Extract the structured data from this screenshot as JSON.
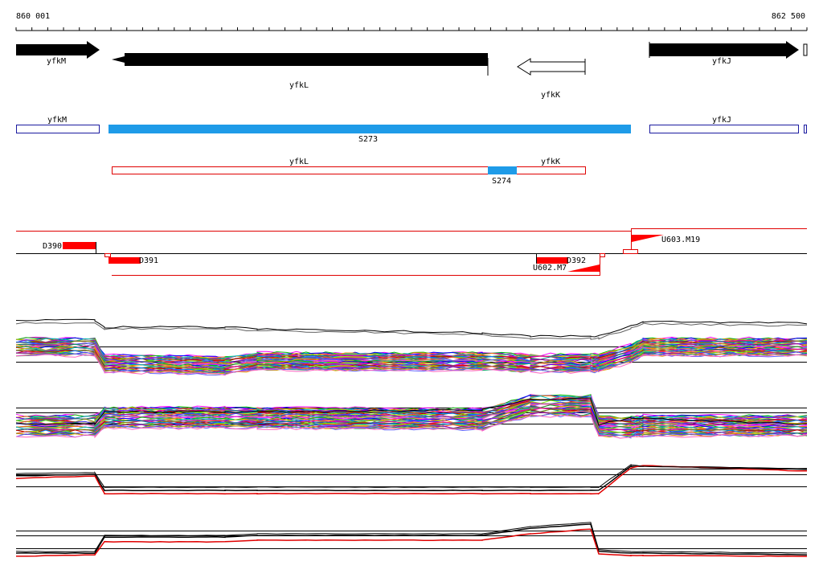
{
  "ruler": {
    "start": "860 001",
    "end": "862 500"
  },
  "genes": [
    {
      "name": "yfkM",
      "strand": "+",
      "start": 860001,
      "end": 860264,
      "style": "filled"
    },
    {
      "name": "yfkL",
      "strand": "-",
      "start": 860300,
      "end": 861500,
      "style": "filled"
    },
    {
      "name": "yfkK",
      "strand": "-",
      "start": 861590,
      "end": 861809,
      "style": "hollow"
    },
    {
      "name": "yfkJ",
      "strand": "+",
      "start": 861999,
      "end": 862484,
      "style": "filled"
    },
    {
      "name": "",
      "strand": "+",
      "start": 862485,
      "end": 862500,
      "style": "hollow"
    }
  ],
  "annotation_row1": [
    {
      "label": "yfkM",
      "start": 860001,
      "end": 860264,
      "color": "#1a1aa0"
    },
    {
      "label": "S273",
      "start": 860289,
      "end": 861939,
      "color": "#1e9be8",
      "filled": true
    },
    {
      "label": "yfkJ",
      "start": 861999,
      "end": 862484,
      "color": "#1a1aa0"
    },
    {
      "label": "",
      "start": 862490,
      "end": 862500,
      "color": "#1a1aa0"
    }
  ],
  "annotation_row2": [
    {
      "label": "yfkL",
      "start": 860300,
      "end": 861500,
      "color": "#e00000"
    },
    {
      "label": "S274",
      "start": 861500,
      "end": 861590,
      "color": "#1e9be8",
      "filled": true
    },
    {
      "label": "yfkK",
      "start": 861590,
      "end": 861809,
      "color": "#e00000"
    }
  ],
  "features": [
    {
      "label": "D390",
      "type": "block",
      "start": 860150,
      "end": 860250
    },
    {
      "label": "D391",
      "type": "block",
      "start": 860289,
      "end": 860390
    },
    {
      "label": "D392",
      "type": "block",
      "start": 861500,
      "end": 861590
    },
    {
      "label": "U602.M7",
      "type": "flag-up"
    },
    {
      "label": "U603.M19",
      "type": "flag-down"
    }
  ],
  "colors": {
    "gene_fill": "#000000",
    "annotation_blue": "#1e9be8",
    "outline_blue": "#1a1aa0",
    "outline_red": "#e00000",
    "feature_red": "#ff0000"
  }
}
